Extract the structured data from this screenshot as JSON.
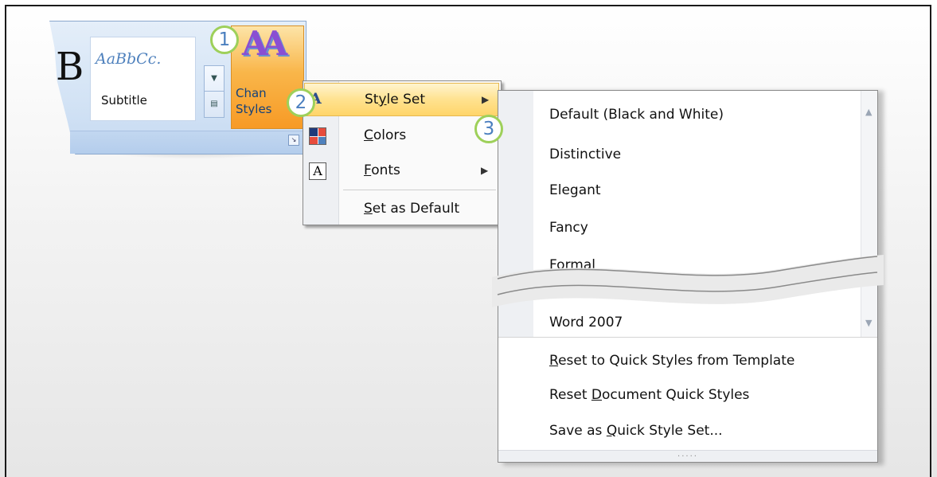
{
  "ribbon": {
    "partial_letter": "B",
    "style_sample": "AaBbCc.",
    "style_label": "Subtitle",
    "change_styles_label_line1": "Chan",
    "change_styles_label_line2": "Styles"
  },
  "callouts": [
    "1",
    "2",
    "3"
  ],
  "menu": {
    "items": [
      {
        "label_prefix": "St",
        "label_underline": "y",
        "label_suffix": "le Set",
        "icon": "style-set-icon",
        "has_submenu": true
      },
      {
        "label_prefix": "",
        "label_underline": "C",
        "label_suffix": "olors",
        "icon": "colors-icon",
        "has_submenu": false
      },
      {
        "label_prefix": "",
        "label_underline": "F",
        "label_suffix": "onts",
        "icon": "fonts-icon",
        "has_submenu": true
      },
      {
        "label_prefix": "",
        "label_underline": "S",
        "label_suffix": "et as Default",
        "icon": "",
        "has_submenu": false
      }
    ]
  },
  "gallery": {
    "items": [
      "Default (Black and White)",
      "Distinctive",
      "Elegant",
      "Fancy",
      "Formal",
      "Word 2007"
    ],
    "commands": [
      {
        "prefix": "",
        "underline": "R",
        "suffix": "eset to Quick Styles from Template"
      },
      {
        "prefix": "Reset ",
        "underline": "D",
        "suffix": "ocument Quick Styles"
      },
      {
        "prefix": "Save as ",
        "underline": "Q",
        "suffix": "uick Style Set..."
      }
    ],
    "grip": "....."
  },
  "colors": {
    "accent_orange": "#f79a25",
    "highlight": "#ffe28f",
    "callout_ring": "#9ed05a"
  }
}
